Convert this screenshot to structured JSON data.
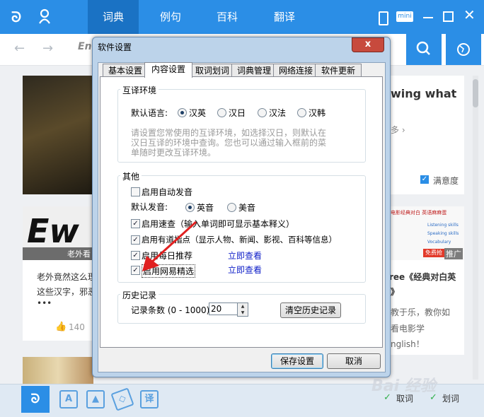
{
  "app": {
    "nav_tabs": [
      {
        "label": "词典"
      },
      {
        "label": "例句"
      },
      {
        "label": "百科"
      },
      {
        "label": "翻译"
      }
    ],
    "mini_label": "mini",
    "search_fragment": "En"
  },
  "background": {
    "right_headline": "wing what",
    "right_more": "多 ›",
    "satisfaction_label": "满意度",
    "card_left_overlay": "老外看",
    "card_left_title_1": "老外竟然这么理",
    "card_left_title_2": "这些汉字，邪恶",
    "card_left_more": "•••",
    "card_left_likes": "140",
    "card_right_tag": "推广",
    "card_right_title": "ree《经典对白英",
    "card_right_title_2": "》",
    "card_right_desc_1": "教于乐，教你如",
    "card_right_desc_2": "看电影学",
    "card_right_desc_3": "nglish！",
    "ad_brand": "电影经典对白 英语麻麻蛋",
    "ad_lines": [
      "Listening skills",
      "Speaking skills",
      "Vocabulary"
    ],
    "ad_button": "免费抢"
  },
  "bottom_bar": {
    "quick_lookup_label": "取词",
    "selection_lookup_label": "划词",
    "watermark": "Bai 经验"
  },
  "dialog": {
    "title": "软件设置",
    "close_symbol": "x",
    "tabs": [
      {
        "label": "基本设置"
      },
      {
        "label": "内容设置"
      },
      {
        "label": "取词划词"
      },
      {
        "label": "词典管理"
      },
      {
        "label": "网络连接"
      },
      {
        "label": "软件更新"
      }
    ],
    "active_tab": "内容设置",
    "mutual_section": {
      "legend": "互译环境",
      "default_language_label": "默认语言:",
      "options": [
        {
          "label": "汉英",
          "selected": true
        },
        {
          "label": "汉日",
          "selected": false
        },
        {
          "label": "汉法",
          "selected": false
        },
        {
          "label": "汉韩",
          "selected": false
        }
      ],
      "hint_lines": [
        "请设置您常使用的互译环境，如选择汉日，则默认在",
        "汉日互译的环境中查询。您也可以通过输入框前的菜",
        "单随时更改互译环境。"
      ]
    },
    "other_section": {
      "legend": "其他",
      "auto_pronounce_label": "启用自动发音",
      "auto_pronounce_checked": false,
      "default_pronounce_label": "默认发音:",
      "pronounce_options": [
        {
          "label": "英音",
          "selected": true
        },
        {
          "label": "美音",
          "selected": false
        }
      ],
      "quick_lookup_label": "启用速查（输入单词即可显示基本释义）",
      "quick_lookup_checked": true,
      "guide_label": "启用有道指点（显示人物、新闻、影视、百科等信息）",
      "guide_checked": true,
      "daily_label": "启用每日推荐",
      "daily_checked": true,
      "daily_link": "立即查看",
      "netease_label": "启用网易精选",
      "netease_checked": true,
      "netease_link": "立即查看"
    },
    "history_section": {
      "legend": "历史记录",
      "count_label": "记录条数 (0 - 1000)",
      "count_value": "20",
      "clear_button": "清空历史记录"
    },
    "save_button": "保存设置",
    "cancel_button": "取消"
  },
  "colors": {
    "brand_blue": "#2b8ee6",
    "arrow_red": "#e02020"
  }
}
